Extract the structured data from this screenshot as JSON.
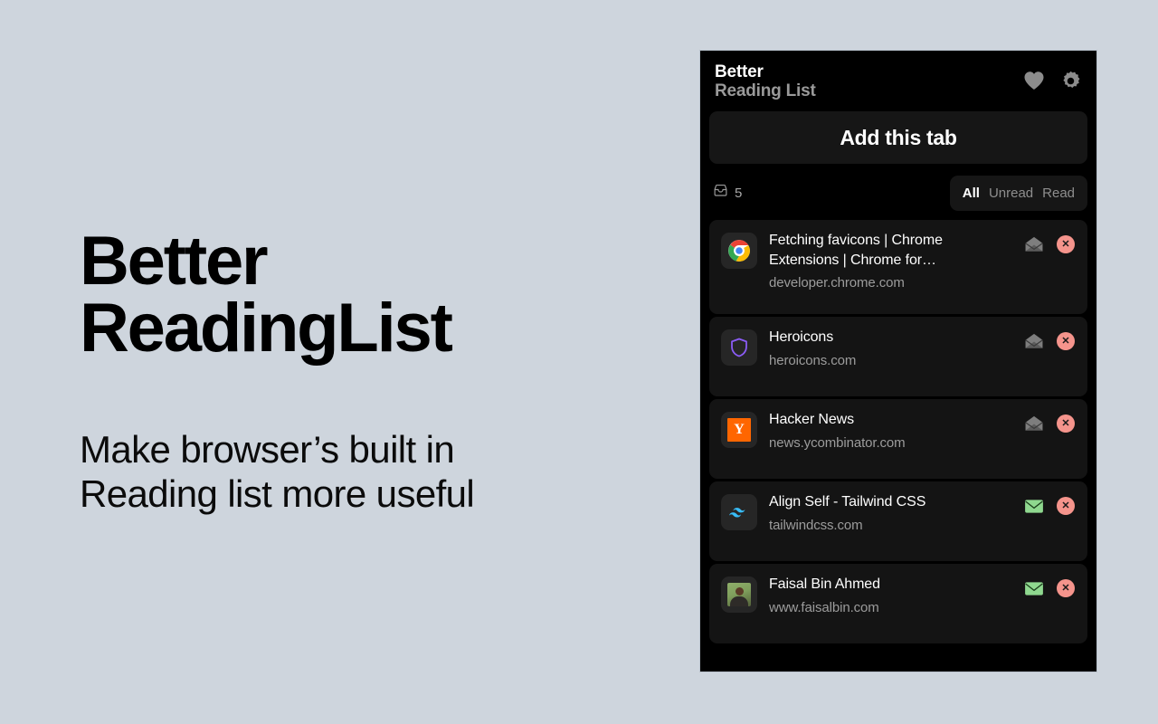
{
  "promo": {
    "title": "Better\nReadingList",
    "subtitle": "Make browser’s built in\nReading list more useful"
  },
  "popup": {
    "brand": {
      "line1": "Better",
      "line2": "Reading List"
    },
    "header_icons": [
      {
        "name": "heart-icon",
        "label": "Favorites"
      },
      {
        "name": "gear-icon",
        "label": "Settings"
      }
    ],
    "add_tab_label": "Add this tab",
    "filter": {
      "inbox_icon": "inbox-icon",
      "count": "5",
      "options": [
        {
          "label": "All",
          "active": true
        },
        {
          "label": "Unread",
          "active": false
        },
        {
          "label": "Read",
          "active": false
        }
      ]
    },
    "items": [
      {
        "title": "Fetching favicons  |  Chrome Extensions  |  Chrome for…",
        "url": "developer.chrome.com",
        "favicon": "chrome-icon",
        "read_state": "read",
        "envelope_icon": "envelope-open-icon",
        "close_icon": "close-icon"
      },
      {
        "title": "Heroicons",
        "url": "heroicons.com",
        "favicon": "shield-icon",
        "read_state": "read",
        "envelope_icon": "envelope-open-icon",
        "close_icon": "close-icon"
      },
      {
        "title": "Hacker News",
        "url": "news.ycombinator.com",
        "favicon": "hackernews-icon",
        "read_state": "read",
        "envelope_icon": "envelope-open-icon",
        "close_icon": "close-icon"
      },
      {
        "title": "Align Self - Tailwind CSS",
        "url": "tailwindcss.com",
        "favicon": "tailwind-icon",
        "read_state": "unread",
        "envelope_icon": "envelope-closed-icon",
        "close_icon": "close-icon"
      },
      {
        "title": "Faisal Bin Ahmed",
        "url": "www.faisalbin.com",
        "favicon": "avatar-icon",
        "read_state": "unread",
        "envelope_icon": "envelope-closed-icon",
        "close_icon": "close-icon"
      }
    ]
  },
  "colors": {
    "page_background": "#ced5dd",
    "popup_background": "#000000",
    "card_background": "#141414",
    "button_background": "#161616",
    "accent_unread": "#8fd88f",
    "accent_read": "#8a8a8a",
    "close_badge": "#f5948c",
    "text_primary": "#ffffff",
    "text_secondary": "#9c9c9c"
  }
}
